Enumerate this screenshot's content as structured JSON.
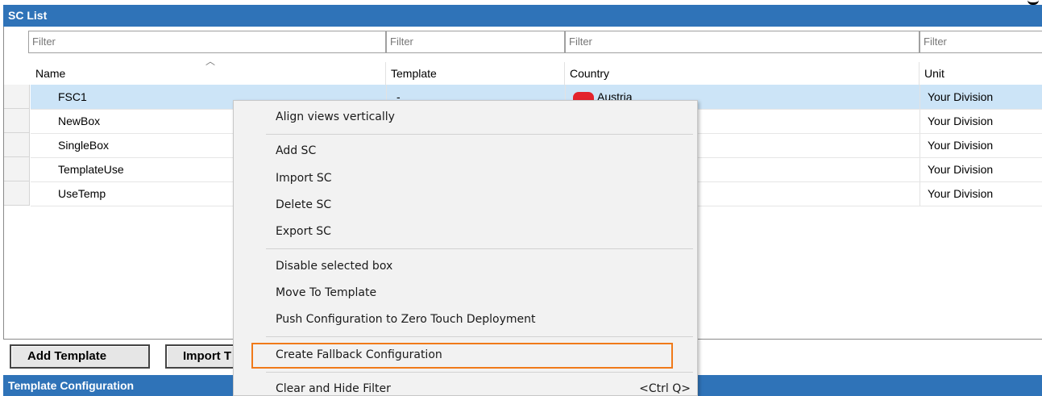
{
  "sc_list": {
    "title": "SC List",
    "filter_placeholder": "Filter",
    "columns": [
      "Name",
      "Template",
      "Country",
      "Unit"
    ],
    "rows": [
      {
        "name": "FSC1",
        "template": "-",
        "country": "Austria",
        "unit": "Your Division",
        "selected": true
      },
      {
        "name": "NewBox",
        "template": "",
        "country": "",
        "unit": "Your Division",
        "selected": false
      },
      {
        "name": "SingleBox",
        "template": "",
        "country": "",
        "unit": "Your Division",
        "selected": false
      },
      {
        "name": "TemplateUse",
        "template": "",
        "country": "",
        "unit": "Your Division",
        "selected": false
      },
      {
        "name": "UseTemp",
        "template": "",
        "country": "",
        "unit": "Your Division",
        "selected": false
      }
    ],
    "selected_row_color": "#cce4f7"
  },
  "buttons": {
    "add_template": "Add Template",
    "import_template": "Import T"
  },
  "template_config": {
    "title": "Template Configuration"
  },
  "context_menu": {
    "items": [
      {
        "label": "Align views vertically"
      },
      {
        "label": "Add SC"
      },
      {
        "label": "Import SC"
      },
      {
        "label": "Delete SC"
      },
      {
        "label": "Export SC"
      },
      {
        "label": "Disable selected box"
      },
      {
        "label": "Move To Template"
      },
      {
        "label": "Push Configuration to Zero Touch Deployment"
      },
      {
        "label": "Create Fallback Configuration",
        "highlighted": true
      },
      {
        "label": "Clear and Hide Filter",
        "shortcut": "<Ctrl Q>"
      }
    ],
    "highlight_color": "#f07a1a"
  },
  "colors": {
    "header_bar": "#2f73b8",
    "austria_flag": "#e3232c"
  }
}
